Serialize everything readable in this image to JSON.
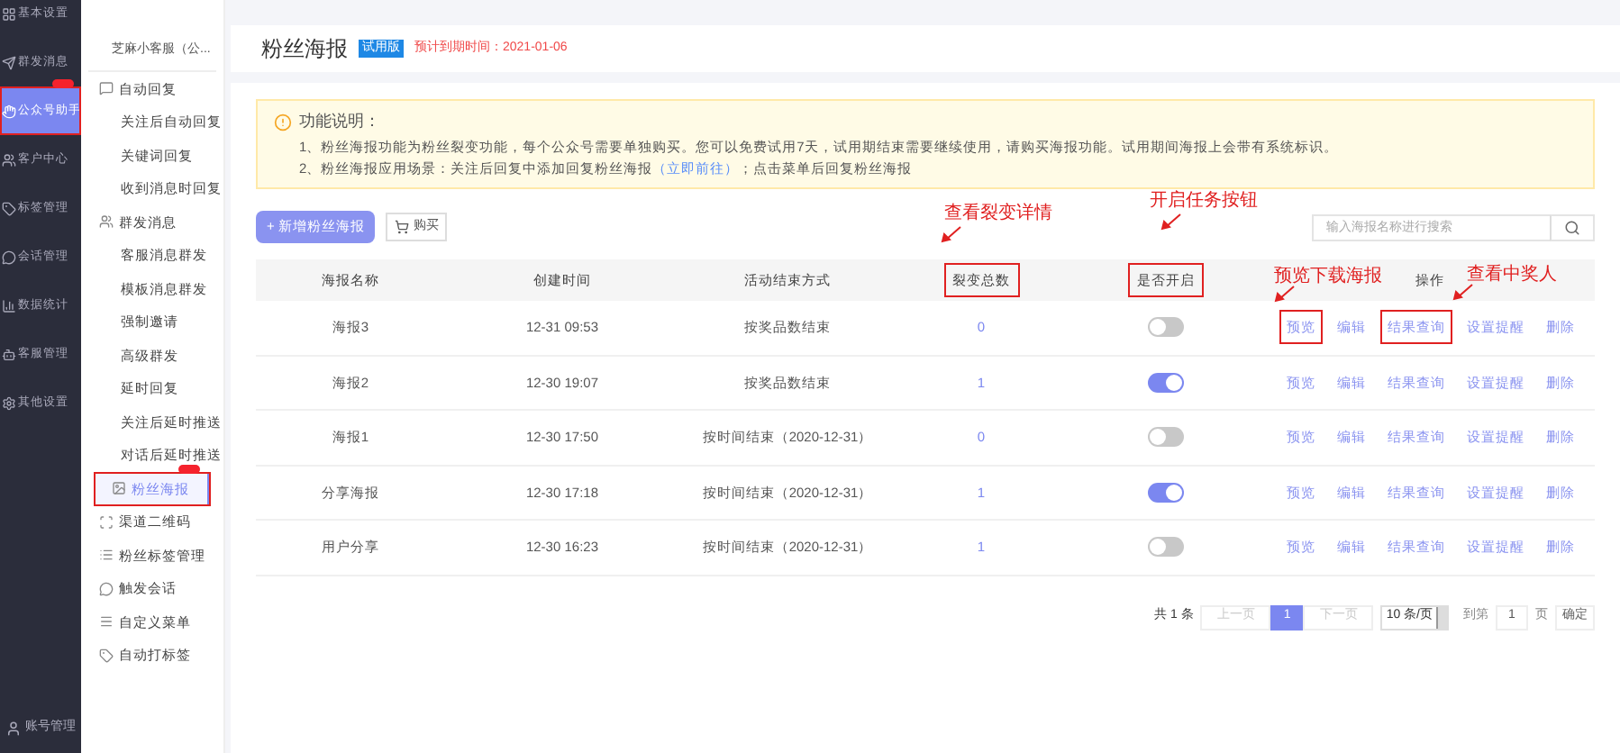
{
  "main_nav": [
    {
      "label": "基本设置",
      "selected": false,
      "highlighted": false,
      "badge": false
    },
    {
      "label": "群发消息",
      "selected": false,
      "highlighted": false,
      "badge": false
    },
    {
      "label": "公众号助手",
      "selected": true,
      "highlighted": true,
      "badge": true
    },
    {
      "label": "客户中心",
      "selected": false,
      "highlighted": false,
      "badge": false
    },
    {
      "label": "标签管理",
      "selected": false,
      "highlighted": false,
      "badge": false
    },
    {
      "label": "会话管理",
      "selected": false,
      "highlighted": false,
      "badge": false
    },
    {
      "label": "数据统计",
      "selected": false,
      "highlighted": false,
      "badge": false
    },
    {
      "label": "客服管理",
      "selected": false,
      "highlighted": false,
      "badge": false
    },
    {
      "label": "其他设置",
      "selected": false,
      "highlighted": false,
      "badge": false
    }
  ],
  "account_nav": {
    "label": "账号管理"
  },
  "sub_nav": {
    "account": "芝麻小客服（公...",
    "items": [
      {
        "kind": "section",
        "label": "自动回复",
        "selected": false,
        "highlighted": false,
        "badge": false
      },
      {
        "kind": "item",
        "label": "关注后自动回复",
        "selected": false,
        "highlighted": false,
        "badge": false
      },
      {
        "kind": "item",
        "label": "关键词回复",
        "selected": false,
        "highlighted": false,
        "badge": false
      },
      {
        "kind": "item",
        "label": "收到消息时回复",
        "selected": false,
        "highlighted": false,
        "badge": false
      },
      {
        "kind": "section",
        "label": "群发消息",
        "selected": false,
        "highlighted": false,
        "badge": false
      },
      {
        "kind": "item",
        "label": "客服消息群发",
        "selected": false,
        "highlighted": false,
        "badge": false
      },
      {
        "kind": "item",
        "label": "模板消息群发",
        "selected": false,
        "highlighted": false,
        "badge": false
      },
      {
        "kind": "item",
        "label": "强制邀请",
        "selected": false,
        "highlighted": false,
        "badge": false
      },
      {
        "kind": "item",
        "label": "高级群发",
        "selected": false,
        "highlighted": false,
        "badge": false
      },
      {
        "kind": "item",
        "label": "延时回复",
        "selected": false,
        "highlighted": false,
        "badge": false
      },
      {
        "kind": "item",
        "label": "关注后延时推送",
        "selected": false,
        "highlighted": false,
        "badge": false
      },
      {
        "kind": "item",
        "label": "对话后延时推送",
        "selected": false,
        "highlighted": false,
        "badge": false
      },
      {
        "kind": "section",
        "label": "粉丝海报",
        "selected": true,
        "highlighted": true,
        "badge": true
      },
      {
        "kind": "section",
        "label": "渠道二维码",
        "selected": false,
        "highlighted": false,
        "badge": false
      },
      {
        "kind": "section",
        "label": "粉丝标签管理",
        "selected": false,
        "highlighted": false,
        "badge": false
      },
      {
        "kind": "section",
        "label": "触发会话",
        "selected": false,
        "highlighted": false,
        "badge": false
      },
      {
        "kind": "section",
        "label": "自定义菜单",
        "selected": false,
        "highlighted": false,
        "badge": false
      },
      {
        "kind": "section",
        "label": "自动打标签",
        "selected": false,
        "highlighted": false,
        "badge": false
      }
    ]
  },
  "page": {
    "title": "粉丝海报",
    "badge": "试用版",
    "expiry": "预计到期时间：2021-01-06"
  },
  "notice": {
    "title": "功能说明：",
    "lines": [
      {
        "text": "1、粉丝海报功能为粉丝裂变功能，每个公众号需要单独购买。您可以免费试用7天，试用期结束需要继续使用，请购买海报功能。试用期间海报上会带有系统标识。"
      },
      {
        "text": "2、粉丝海报应用场景：关注后回复中添加回复粉丝海报",
        "links": [
          "（立即前往）"
        ],
        "tail": "；点击菜单后回复粉丝海报"
      }
    ]
  },
  "toolbar": {
    "add_button": "+ 新增粉丝海报",
    "buy_button": "购买",
    "search": {
      "placeholder": "输入海报名称进行搜索"
    }
  },
  "annotations": [
    {
      "text": "查看裂变详情"
    },
    {
      "text": "开启任务按钮"
    },
    {
      "text": "预览下载海报"
    },
    {
      "text": "查看中奖人"
    }
  ],
  "table": {
    "columns": [
      {
        "label": "海报名称",
        "highlighted": false
      },
      {
        "label": "创建时间",
        "highlighted": false
      },
      {
        "label": "活动结束方式",
        "highlighted": false
      },
      {
        "label": "裂变总数",
        "highlighted": true
      },
      {
        "label": "是否开启",
        "highlighted": true
      },
      {
        "label": "操作",
        "highlighted": false
      }
    ],
    "rows": [
      {
        "name": "海报3",
        "created": "12-31 09:53",
        "end_mode": "按奖品数结束",
        "total": "0",
        "on": false,
        "actions": [
          {
            "label": "预览",
            "highlighted": true
          },
          {
            "label": "编辑",
            "highlighted": false
          },
          {
            "label": "结果查询",
            "highlighted": true
          },
          {
            "label": "设置提醒",
            "highlighted": false
          },
          {
            "label": "删除",
            "highlighted": false
          }
        ]
      },
      {
        "name": "海报2",
        "created": "12-30 19:07",
        "end_mode": "按奖品数结束",
        "total": "1",
        "on": true,
        "actions": [
          {
            "label": "预览",
            "highlighted": false
          },
          {
            "label": "编辑",
            "highlighted": false
          },
          {
            "label": "结果查询",
            "highlighted": false
          },
          {
            "label": "设置提醒",
            "highlighted": false
          },
          {
            "label": "删除",
            "highlighted": false
          }
        ]
      },
      {
        "name": "海报1",
        "created": "12-30 17:50",
        "end_mode": "按时间结束（2020-12-31）",
        "total": "0",
        "on": false,
        "actions": [
          {
            "label": "预览",
            "highlighted": false
          },
          {
            "label": "编辑",
            "highlighted": false
          },
          {
            "label": "结果查询",
            "highlighted": false
          },
          {
            "label": "设置提醒",
            "highlighted": false
          },
          {
            "label": "删除",
            "highlighted": false
          }
        ]
      },
      {
        "name": "分享海报",
        "created": "12-30 17:18",
        "end_mode": "按时间结束（2020-12-31）",
        "total": "1",
        "on": true,
        "actions": [
          {
            "label": "预览",
            "highlighted": false
          },
          {
            "label": "编辑",
            "highlighted": false
          },
          {
            "label": "结果查询",
            "highlighted": false
          },
          {
            "label": "设置提醒",
            "highlighted": false
          },
          {
            "label": "删除",
            "highlighted": false
          }
        ]
      },
      {
        "name": "用户分享",
        "created": "12-30 16:23",
        "end_mode": "按时间结束（2020-12-31）",
        "total": "1",
        "on": false,
        "actions": [
          {
            "label": "预览",
            "highlighted": false
          },
          {
            "label": "编辑",
            "highlighted": false
          },
          {
            "label": "结果查询",
            "highlighted": false
          },
          {
            "label": "设置提醒",
            "highlighted": false
          },
          {
            "label": "删除",
            "highlighted": false
          }
        ]
      }
    ]
  },
  "pagination": {
    "total": "共 1 条",
    "prev": "上一页",
    "pages": [
      {
        "label": "1",
        "selected": true
      }
    ],
    "next": "下一页",
    "page_size": "10 条/页",
    "goto": "到第",
    "goto_value": "1",
    "page_unit": "页",
    "confirm": "确定"
  }
}
